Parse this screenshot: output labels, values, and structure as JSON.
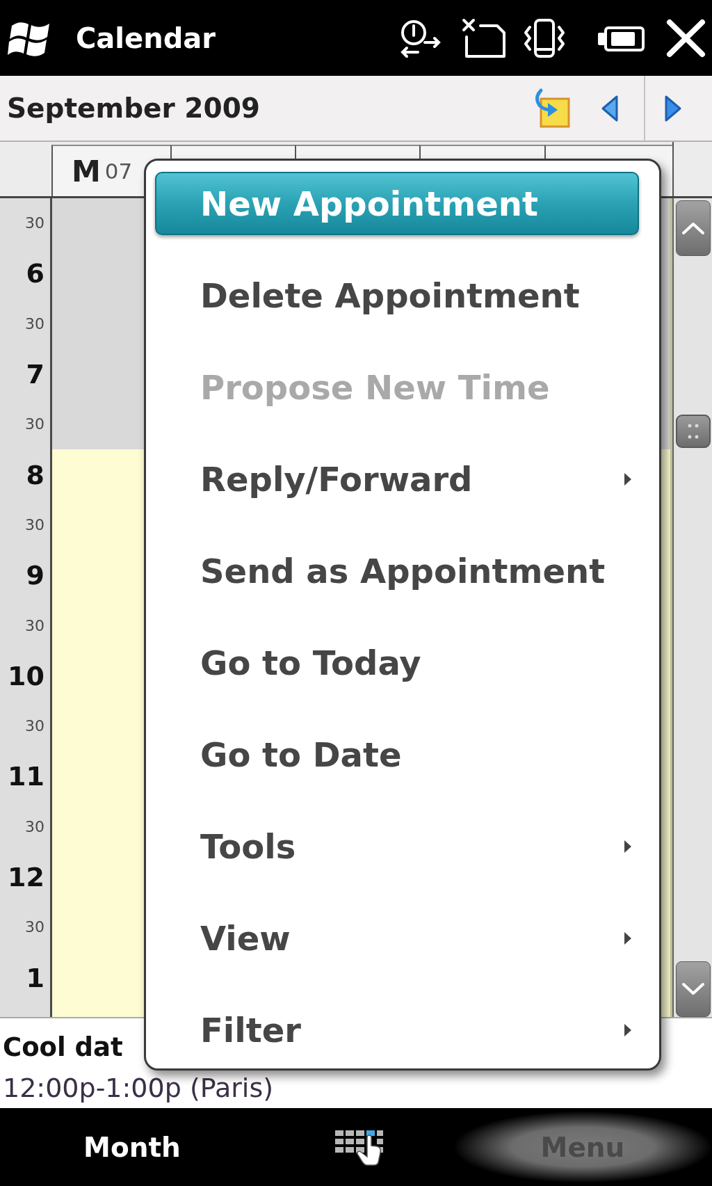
{
  "title_bar": {
    "title": "Calendar"
  },
  "month_header": {
    "label": "September 2009"
  },
  "day_header": {
    "weekday": "M",
    "date": "07"
  },
  "time_rows": [
    {
      "label": "30",
      "kind": "half",
      "working": false
    },
    {
      "label": "6",
      "kind": "hour",
      "working": false
    },
    {
      "label": "30",
      "kind": "half",
      "working": false
    },
    {
      "label": "7",
      "kind": "hour",
      "working": false
    },
    {
      "label": "30",
      "kind": "half",
      "working": false
    },
    {
      "label": "8",
      "kind": "hour",
      "working": true
    },
    {
      "label": "30",
      "kind": "half",
      "working": true
    },
    {
      "label": "9",
      "kind": "hour",
      "working": true
    },
    {
      "label": "30",
      "kind": "half",
      "working": true
    },
    {
      "label": "10",
      "kind": "hour",
      "working": true
    },
    {
      "label": "30",
      "kind": "half",
      "working": true
    },
    {
      "label": "11",
      "kind": "hour",
      "working": true
    },
    {
      "label": "30",
      "kind": "half",
      "working": true
    },
    {
      "label": "12",
      "kind": "hour",
      "working": true
    },
    {
      "label": "30",
      "kind": "half",
      "working": true
    },
    {
      "label": "1",
      "kind": "hour",
      "working": true
    }
  ],
  "appointment": {
    "title": "Cool dat",
    "time": "12:00p-1:00p (Paris)"
  },
  "context_menu": {
    "items": [
      {
        "label": "New Appointment",
        "selected": true,
        "disabled": false,
        "has_submenu": false
      },
      {
        "label": "Delete Appointment",
        "selected": false,
        "disabled": false,
        "has_submenu": false
      },
      {
        "label": "Propose New Time",
        "selected": false,
        "disabled": true,
        "has_submenu": false
      },
      {
        "label": "Reply/Forward",
        "selected": false,
        "disabled": false,
        "has_submenu": true
      },
      {
        "label": "Send as Appointment",
        "selected": false,
        "disabled": false,
        "has_submenu": false
      },
      {
        "label": "Go to Today",
        "selected": false,
        "disabled": false,
        "has_submenu": false
      },
      {
        "label": "Go to Date",
        "selected": false,
        "disabled": false,
        "has_submenu": false
      },
      {
        "label": "Tools",
        "selected": false,
        "disabled": false,
        "has_submenu": true
      },
      {
        "label": "View",
        "selected": false,
        "disabled": false,
        "has_submenu": true
      },
      {
        "label": "Filter",
        "selected": false,
        "disabled": false,
        "has_submenu": true
      }
    ]
  },
  "soft_keys": [
    {
      "label": "Month",
      "pressed": false
    },
    {
      "label": "Menu",
      "pressed": true
    }
  ]
}
